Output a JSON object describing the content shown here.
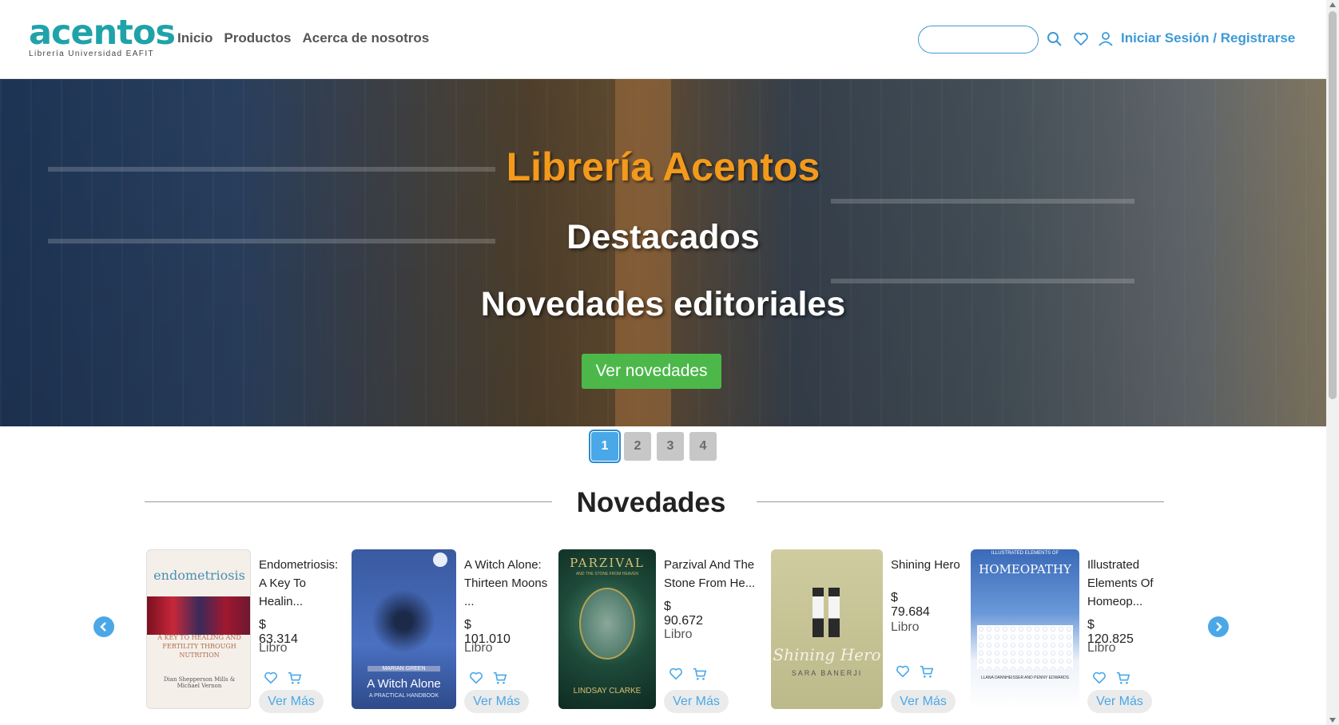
{
  "header": {
    "logo_text": "acentos",
    "logo_subtitle": "Librería Universidad EAFIT",
    "nav": [
      "Inicio",
      "Productos",
      "Acerca de nosotros"
    ],
    "search_placeholder": "",
    "login_label": "Iniciar Sesión / Registrarse"
  },
  "hero": {
    "title": "Librería Acentos",
    "line1": "Destacados",
    "line2": "Novedades editoriales",
    "button_label": "Ver novedades",
    "title_color": "#f39a1c",
    "button_color": "#4cb84a"
  },
  "pager": {
    "pages": [
      "1",
      "2",
      "3",
      "4"
    ],
    "active": "1"
  },
  "section": {
    "title": "Novedades"
  },
  "products": [
    {
      "title_lines": [
        "Endometriosis:",
        "A Key To",
        "Healin..."
      ],
      "price": "$ 63.314",
      "type": "Libro",
      "button": "Ver Más",
      "cover_text": "endometriosis",
      "cover_sub": "A KEY TO HEALING AND FERTILITY THROUGH NUTRITION",
      "cover_authors": "Dian Shepperson Mills & Michael Vernon"
    },
    {
      "title_lines": [
        "A Witch Alone:",
        "Thirteen Moons",
        "..."
      ],
      "price": "$ 101.010",
      "type": "Libro",
      "button": "Ver Más",
      "cover_text": "A Witch Alone",
      "cover_sub": "A PRACTICAL HANDBOOK",
      "cover_authors": "MARIAN GREEN"
    },
    {
      "title_lines": [
        "Parzival And The",
        "Stone From He..."
      ],
      "price": "$ 90.672",
      "type": "Libro",
      "button": "Ver Más",
      "cover_text": "PARZIVAL",
      "cover_sub": "AND THE STONE FROM HEAVEN",
      "cover_authors": "LINDSAY CLARKE"
    },
    {
      "title_lines": [
        "Shining Hero"
      ],
      "price": "$ 79.684",
      "type": "Libro",
      "button": "Ver Más",
      "cover_text": "Shining Hero",
      "cover_sub": "",
      "cover_authors": "SARA BANERJI"
    },
    {
      "title_lines": [
        "Illustrated",
        "Elements Of",
        "Homeop..."
      ],
      "price": "$ 120.825",
      "type": "Libro",
      "button": "Ver Más",
      "cover_text": "HOMEOPATHY",
      "cover_sub": "ILLUSTRATED ELEMENTS OF",
      "cover_authors": "LLANA DANNHEISSER AND PENNY EDWARDS"
    }
  ]
}
